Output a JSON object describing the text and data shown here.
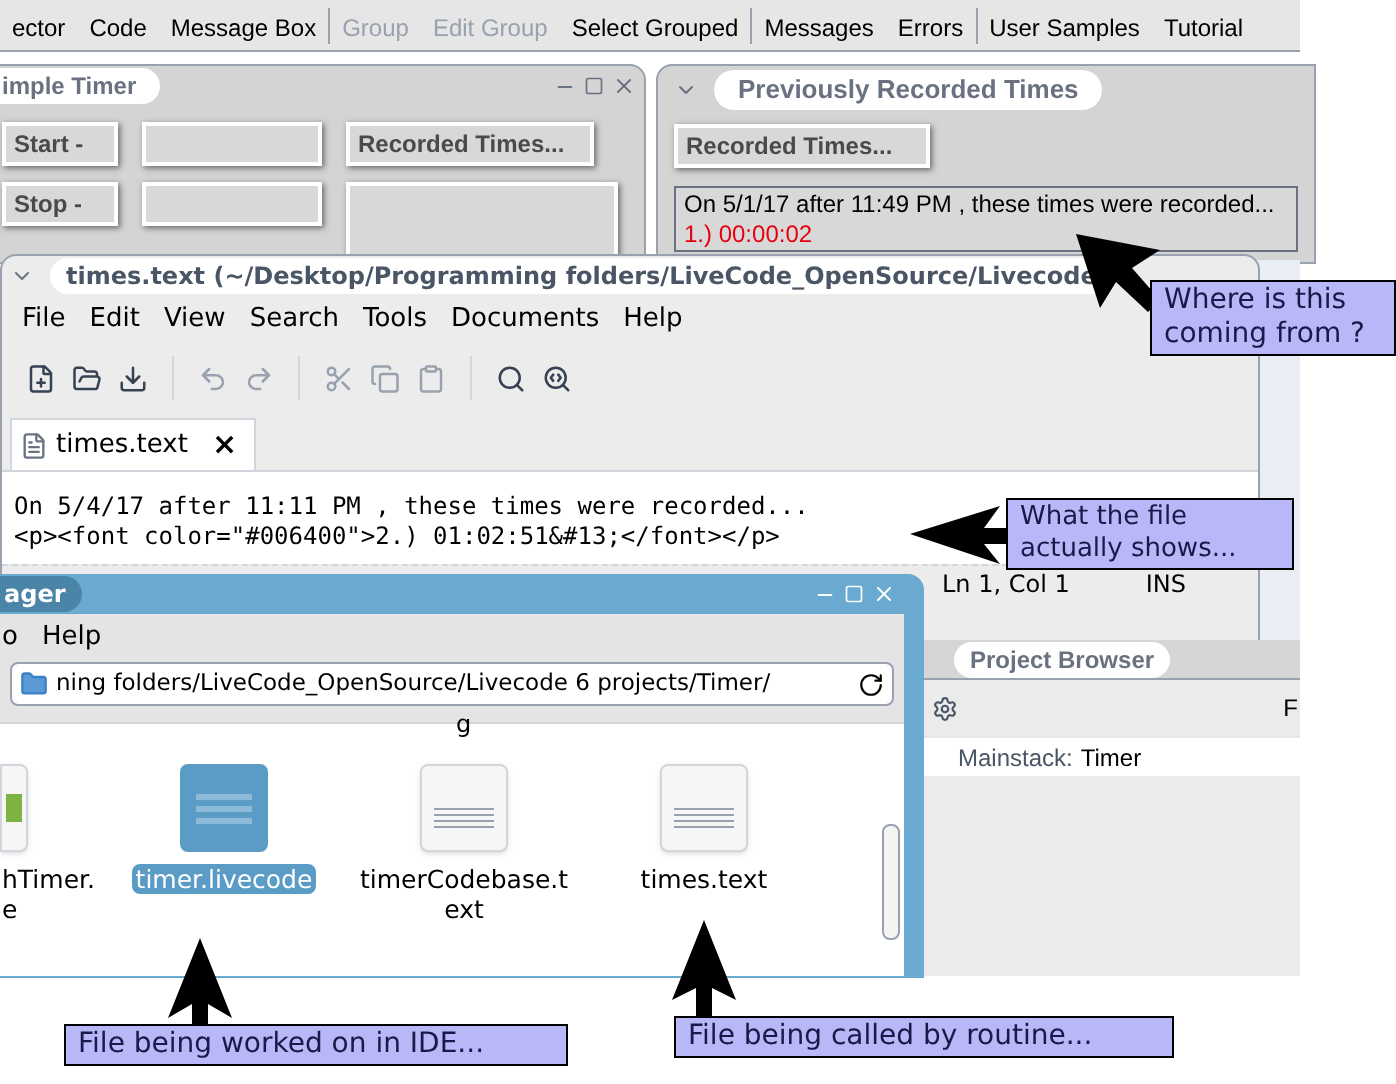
{
  "toolbar": {
    "items": [
      {
        "label": "ector",
        "disabled": false
      },
      {
        "label": "Code",
        "disabled": false
      },
      {
        "label": "Message Box",
        "disabled": false
      },
      {
        "label": "Group",
        "disabled": true
      },
      {
        "label": "Edit Group",
        "disabled": true
      },
      {
        "label": "Select Grouped",
        "disabled": false
      },
      {
        "label": "Messages",
        "disabled": false
      },
      {
        "label": "Errors",
        "disabled": false
      },
      {
        "label": "User Samples",
        "disabled": false
      },
      {
        "label": "Tutorial",
        "disabled": false
      }
    ]
  },
  "simple_timer": {
    "title": "imple Timer",
    "buttons": [
      "Start -",
      "Stop -"
    ],
    "recorded_button": "Recorded Times..."
  },
  "previous_times": {
    "title": "Previously Recorded Times",
    "button": "Recorded Times...",
    "lines": [
      {
        "text": "On 5/1/17 after 11:49 PM , these times were recorded...",
        "kind": "heading"
      },
      {
        "text": "1.) 00:00:02",
        "kind": "entry"
      }
    ]
  },
  "editor": {
    "title": "times.text (~/Desktop/Programming folders/LiveCode_OpenSource/Livecode",
    "menu": [
      "File",
      "Edit",
      "View",
      "Search",
      "Tools",
      "Documents",
      "Help"
    ],
    "tab": {
      "label": "times.text",
      "close": "×"
    },
    "lines": [
      "On 5/4/17 after 11:11 PM , these times were recorded...",
      "<p><font color=\"#006400\">2.) 01:02:51&#13;</font></p>"
    ],
    "status": {
      "position": "Ln 1, Col 1",
      "mode": "INS"
    }
  },
  "file_manager": {
    "title": "ager",
    "menu": [
      "o",
      "Help"
    ],
    "path": "ning folders/LiveCode_OpenSource/Livecode 6 projects/Timer/",
    "cut_label": "g",
    "files": [
      {
        "lines": [
          "hTimer.",
          "e"
        ],
        "kind": "app",
        "selected": false
      },
      {
        "lines": [
          "timer.livecode"
        ],
        "kind": "binary",
        "selected": true
      },
      {
        "lines": [
          "timerCodebase.t",
          "ext"
        ],
        "kind": "text",
        "selected": false
      },
      {
        "lines": [
          "times.text"
        ],
        "kind": "text",
        "selected": false
      }
    ]
  },
  "project_browser": {
    "title": "Project Browser",
    "column_fragment": "F",
    "stack_label": "Mainstack:",
    "stack_name": "Timer"
  },
  "callouts": [
    {
      "text": "Where is this coming from ?"
    },
    {
      "text": "What the file actually shows..."
    },
    {
      "text": "File being worked on in IDE..."
    },
    {
      "text": "File being called by routine..."
    }
  ]
}
